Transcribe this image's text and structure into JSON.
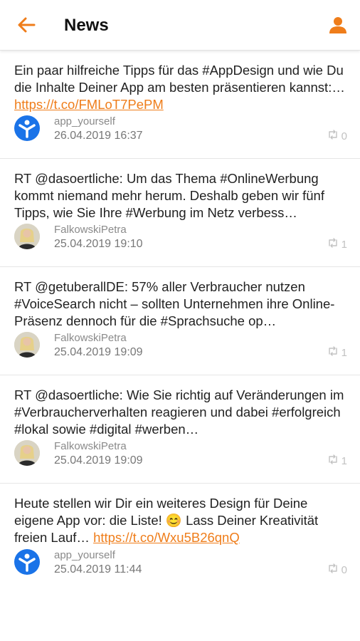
{
  "header": {
    "title": "News"
  },
  "colors": {
    "accent": "#ef7d1a",
    "app_avatar": "#1a73e8"
  },
  "posts": [
    {
      "text": "Ein paar hilfreiche Tipps für das #AppDesign und wie Du die Inhalte Deiner App am besten präsentieren kannst:… ",
      "link": "https://t.co/FMLoT7PePM",
      "author": "app_yourself",
      "date": "26.04.2019 16:37",
      "retweets": "0",
      "avatar": "app-logo"
    },
    {
      "text": "RT @dasoertliche: Um das Thema #OnlineWerbung kommt niemand mehr herum. Deshalb geben wir fünf Tipps, wie Sie Ihre #Werbung im Netz verbess…",
      "link": "",
      "author": "FalkowskiPetra",
      "date": "25.04.2019 19:10",
      "retweets": "1",
      "avatar": "person-photo"
    },
    {
      "text": "RT @getuberallDE: 57% aller Verbraucher nutzen #VoiceSearch nicht – sollten Unternehmen ihre Online-Präsenz dennoch für die #Sprachsuche op…",
      "link": "",
      "author": "FalkowskiPetra",
      "date": "25.04.2019 19:09",
      "retweets": "1",
      "avatar": "person-photo"
    },
    {
      "text": "RT @dasoertliche: Wie Sie richtig auf Veränderungen im #Verbraucherverhalten reagieren und dabei #erfolgreich #lokal sowie #digital #werben…",
      "link": "",
      "author": "FalkowskiPetra",
      "date": "25.04.2019 19:09",
      "retweets": "1",
      "avatar": "person-photo"
    },
    {
      "text": "Heute stellen wir Dir ein weiteres Design für Deine eigene App vor: die Liste! 😊 Lass Deiner Kreativität freien Lauf… ",
      "link": "https://t.co/Wxu5B26qnQ",
      "author": "app_yourself",
      "date": "25.04.2019 11:44",
      "retweets": "0",
      "avatar": "app-logo"
    }
  ]
}
